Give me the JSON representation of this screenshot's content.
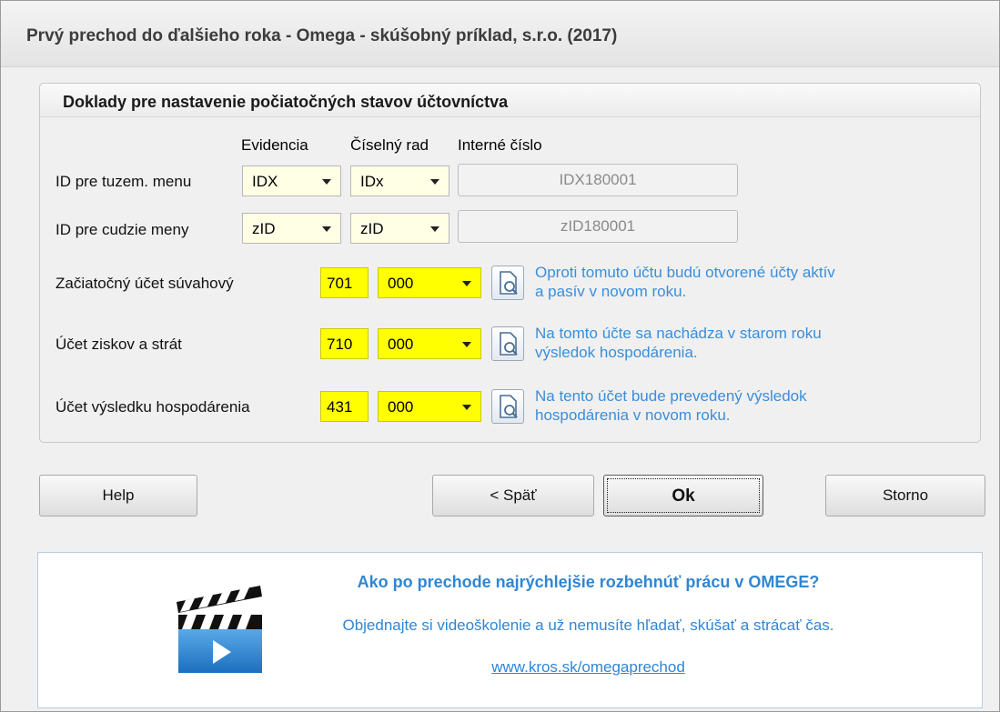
{
  "window": {
    "title": "Prvý prechod do ďalšieho roka - Omega - skúšobný príklad, s.r.o. (2017)"
  },
  "group": {
    "title": "Doklady pre nastavenie počiatočných stavov účtovníctva",
    "columns": {
      "evidencia": "Evidencia",
      "ciselny_rad": "Číselný rad",
      "interne_cislo": "Interné číslo"
    },
    "rows": [
      {
        "label": "ID pre tuzem. menu",
        "evidencia": "IDX",
        "ciselny_rad": "IDx",
        "interne_cislo": "IDX180001"
      },
      {
        "label": "ID pre cudzie meny",
        "evidencia": "zID",
        "ciselny_rad": "zID",
        "interne_cislo": "zID180001"
      }
    ],
    "accounts": [
      {
        "label": "Začiatočný účet súvahový",
        "synth": "701",
        "analyt": "000",
        "hint_line1": "Oproti tomuto účtu budú otvorené účty aktív",
        "hint_line2": "a pasív v novom roku."
      },
      {
        "label": "Účet ziskov a strát",
        "synth": "710",
        "analyt": "000",
        "hint_line1": "Na tomto účte sa nachádza v starom roku",
        "hint_line2": "výsledok hospodárenia."
      },
      {
        "label": "Účet výsledku hospodárenia",
        "synth": "431",
        "analyt": "000",
        "hint_line1": "Na tento účet bude prevedený výsledok",
        "hint_line2": "hospodárenia v novom roku."
      }
    ]
  },
  "buttons": {
    "help": "Help",
    "back": "< Späť",
    "ok": "Ok",
    "cancel": "Storno"
  },
  "promo": {
    "title": "Ako po prechode najrýchlejšie rozbehnúť prácu v OMEGE?",
    "subtitle": "Objednajte si videoškolenie a už nemusíte hľadať, skúšať a strácať čas.",
    "link": "www.kros.sk/omegaprechod"
  },
  "colors": {
    "accent_blue": "#2f86d4",
    "required_yellow": "#ffff00"
  }
}
